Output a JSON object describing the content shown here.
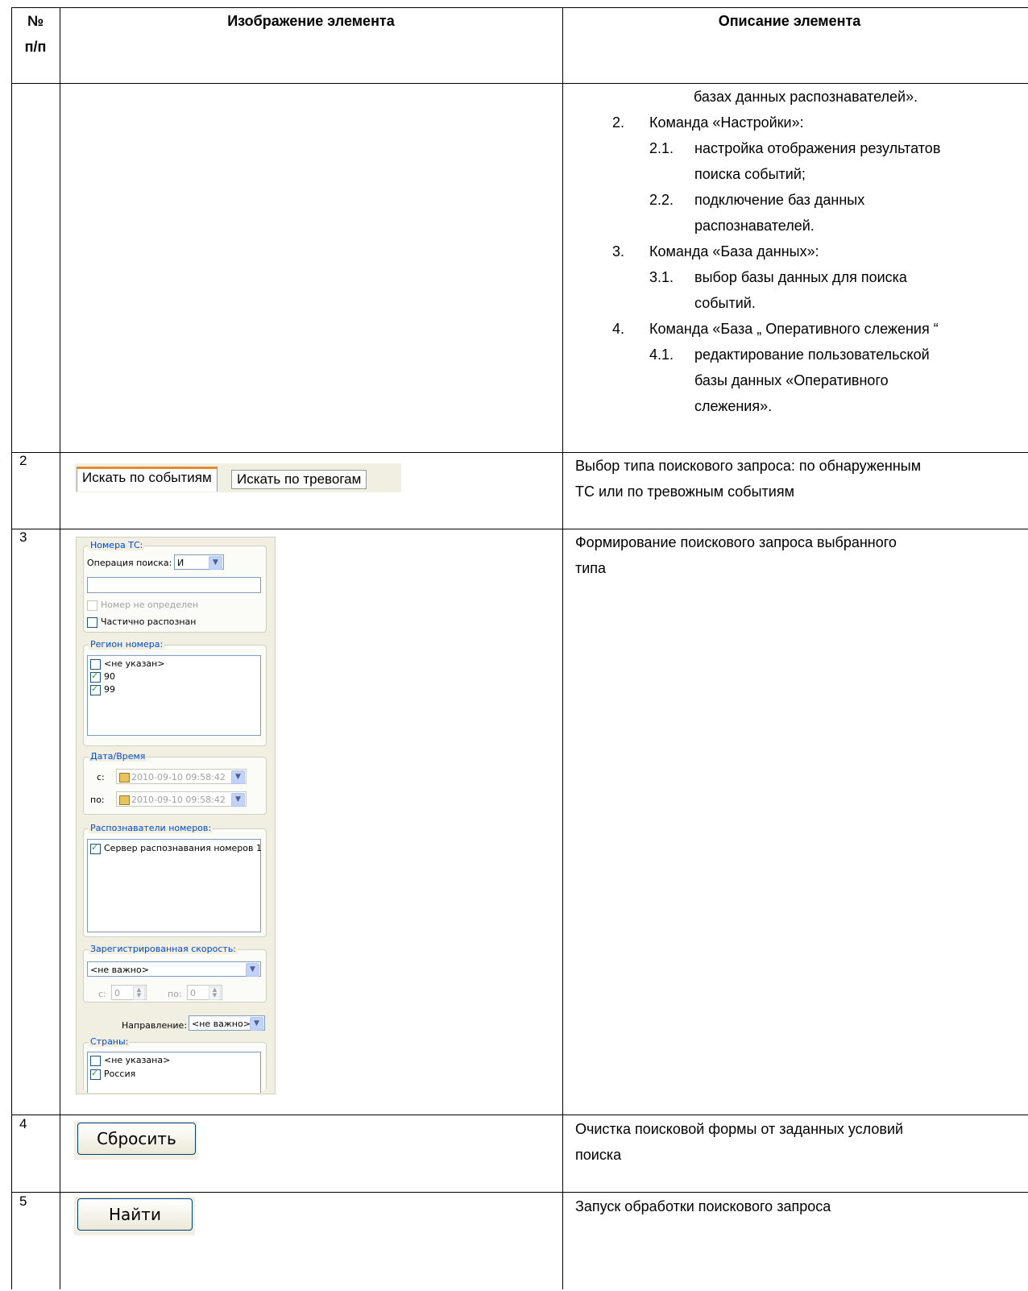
{
  "header": {
    "col_num": "№ п/п",
    "col_image": "Изображение элемента",
    "col_desc": "Описание элемента"
  },
  "row1": {
    "cont": "базах данных распознавателей».",
    "items": [
      {
        "n": "2.",
        "text": "Команда «Настройки»:"
      },
      {
        "n": "2.1.",
        "text": "настройка отображения результатов"
      },
      {
        "n": "",
        "text": "поиска событий;"
      },
      {
        "n": "2.2.",
        "text": "подключение баз данных"
      },
      {
        "n": "",
        "text": "распознавателей."
      },
      {
        "n": "3.",
        "text": "Команда «База данных»:"
      },
      {
        "n": "3.1.",
        "text": "выбор базы данных для поиска"
      },
      {
        "n": "",
        "text": "событий."
      },
      {
        "n": "4.",
        "text": "Команда «База „ Оперативного слежения “"
      },
      {
        "n": "4.1.",
        "text": "редактирование пользовательской"
      },
      {
        "n": "",
        "text": "базы данных «Оперативного"
      },
      {
        "n": "",
        "text": "слежения»."
      }
    ]
  },
  "row2": {
    "num": "2",
    "tab_events": "Искать по событиям",
    "tab_alarms": "Искать по тревогам",
    "desc_line1": "Выбор типа поискового запроса: по обнаруженным",
    "desc_line2": "ТС или по тревожным событиям"
  },
  "row3": {
    "num": "3",
    "desc_line1": "Формирование поискового запроса выбранного",
    "desc_line2": "типа",
    "form": {
      "plates_title": "Номера ТС:",
      "operation_label": "Операция поиска:",
      "operation_value": "И",
      "plate_input": "",
      "not_detected": "Номер не определен",
      "partial": "Частично распознан",
      "region_title": "Регион номера:",
      "regions": [
        "<не указан>",
        "90",
        "99"
      ],
      "regions_checked": [
        false,
        true,
        true
      ],
      "datetime_title": "Дата/Время",
      "from_label": "с:",
      "to_label": "по:",
      "from_value": "2010-09-10 09:58:42",
      "to_value": "2010-09-10 09:58:42",
      "recognizers_title": "Распознаватели номеров:",
      "recognizer": "Сервер распознавания номеров 1",
      "speed_title": "Зарегистрированная скорость:",
      "speed_value": "<не важно>",
      "speed_from_label": "с:",
      "speed_from": "0",
      "speed_to_label": "по:",
      "speed_to": "0",
      "direction_label": "Направление:",
      "direction_value": "<не важно>",
      "countries_title": "Страны:",
      "countries": [
        "<не указана>",
        "Россия"
      ],
      "countries_checked": [
        false,
        true
      ]
    }
  },
  "row4": {
    "num": "4",
    "button": "Сбросить",
    "desc_line1": "Очистка поисковой формы от заданных условий",
    "desc_line2": "поиска"
  },
  "row5": {
    "num": "5",
    "button": "Найти",
    "desc_line1": "Запуск обработки поискового запроса"
  }
}
